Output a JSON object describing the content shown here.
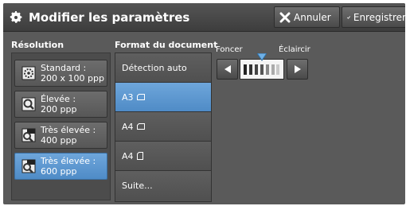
{
  "header": {
    "title": "Modifier les paramètres",
    "cancel_label": "Annuler",
    "save_label": "Enregistrer"
  },
  "resolution": {
    "label": "Résolution",
    "options": [
      {
        "line1": "Standard :",
        "line2": "200 x 100 ppp",
        "icon": "standard-resolution-icon",
        "selected": false
      },
      {
        "line1": "Élevée :",
        "line2": "200 ppp",
        "icon": "high-resolution-icon",
        "selected": false
      },
      {
        "line1": "Très élevée :",
        "line2": "400 ppp",
        "icon": "very-high-400-icon",
        "selected": false
      },
      {
        "line1": "Très élevée :",
        "line2": "600 ppp",
        "icon": "very-high-600-icon",
        "selected": true
      }
    ]
  },
  "format": {
    "label": "Format du document",
    "items": [
      {
        "label": "Détection auto",
        "selected": false
      },
      {
        "label": "A3",
        "orientation": "landscape",
        "selected": true
      },
      {
        "label": "A4",
        "orientation": "landscape",
        "selected": false
      },
      {
        "label": "A4",
        "orientation": "portrait",
        "selected": false
      },
      {
        "label": "Suite...",
        "selected": false
      }
    ]
  },
  "density": {
    "darker_label": "Foncer",
    "lighter_label": "Éclaircir",
    "level": 4,
    "levels": 7
  },
  "colors": {
    "panel": "#5a5a5a",
    "selected": "#5b97d1",
    "marker": "#6fb0e6"
  }
}
